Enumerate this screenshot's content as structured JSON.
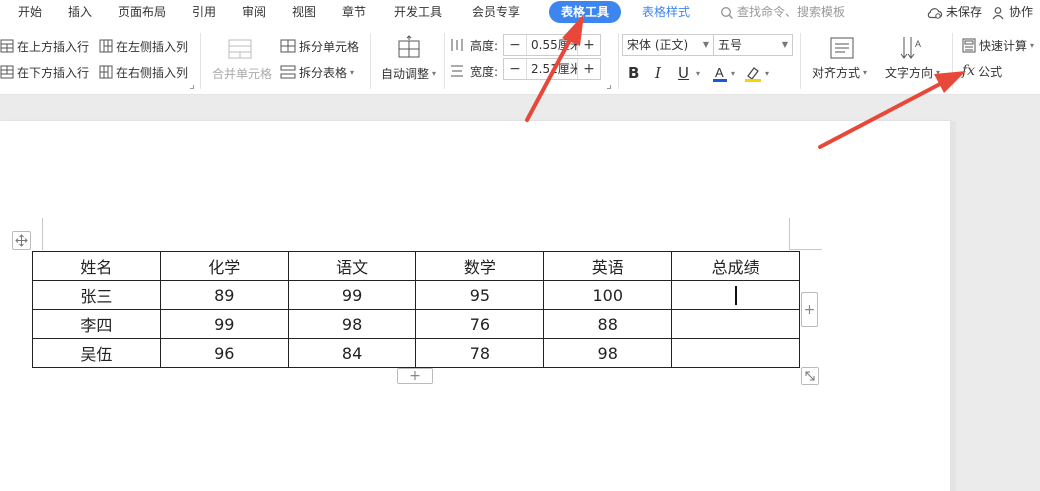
{
  "tabs": [
    {
      "label": "开始"
    },
    {
      "label": "插入"
    },
    {
      "label": "页面布局"
    },
    {
      "label": "引用"
    },
    {
      "label": "审阅"
    },
    {
      "label": "视图"
    },
    {
      "label": "章节"
    },
    {
      "label": "开发工具"
    },
    {
      "label": "会员专享"
    },
    {
      "label": "表格工具"
    },
    {
      "label": "表格样式"
    }
  ],
  "search_label": "查找命令、搜索模板",
  "status": {
    "unsaved": "未保存",
    "collab": "协作"
  },
  "ribbon": {
    "insert_above": "在上方插入行",
    "insert_below": "在下方插入行",
    "insert_left": "在左侧插入列",
    "insert_right": "在右侧插入列",
    "merge_cells": "合并单元格",
    "split_cells": "拆分单元格",
    "split_table": "拆分表格",
    "auto_fit": "自动调整",
    "height_label": "高度:",
    "height_value": "0.55厘米",
    "width_label": "宽度:",
    "width_value": "2.51厘米",
    "font_name": "宋体 (正文)",
    "font_size": "五号",
    "align": "对齐方式",
    "text_dir": "文字方向",
    "quick_calc": "快速计算",
    "formula": "公式"
  },
  "table": {
    "headers": [
      "姓名",
      "化学",
      "语文",
      "数学",
      "英语",
      "总成绩"
    ],
    "rows": [
      [
        "张三",
        "89",
        "99",
        "95",
        "100",
        ""
      ],
      [
        "李四",
        "99",
        "98",
        "76",
        "88",
        ""
      ],
      [
        "吴伍",
        "96",
        "84",
        "78",
        "98",
        ""
      ]
    ]
  },
  "colors": {
    "accent": "#3d86f0",
    "arrow": "#e8483a",
    "underline_color": "#1a56d6",
    "highlight": "#f5d50a"
  }
}
